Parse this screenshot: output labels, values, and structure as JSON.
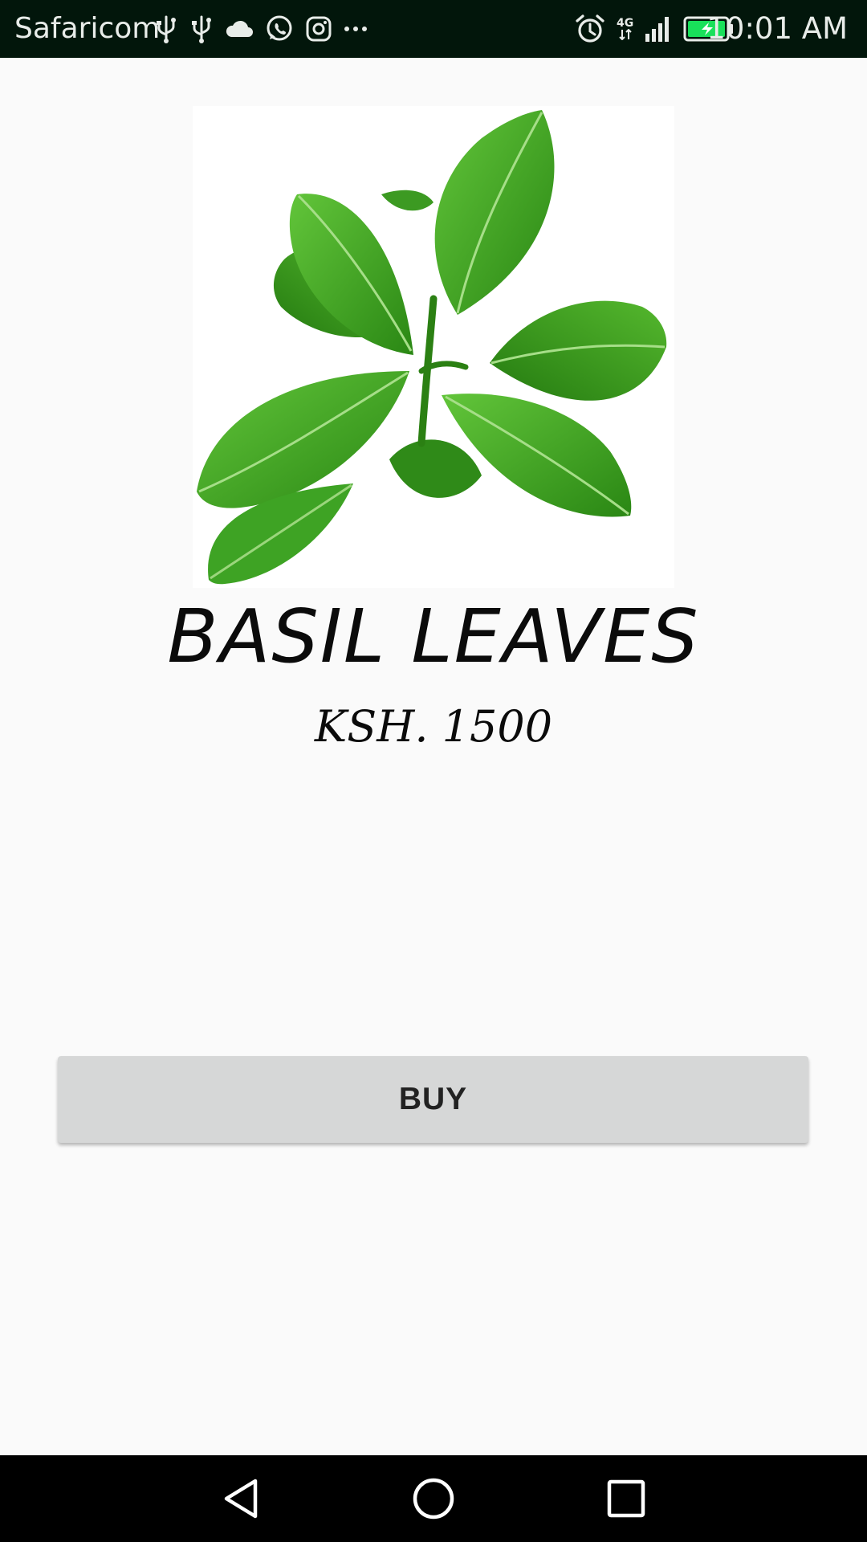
{
  "status_bar": {
    "carrier": "Safaricom",
    "time": "10:01 AM",
    "network_label": "4G",
    "left_icons": [
      "usb-icon",
      "usb-icon",
      "cloud-icon",
      "whatsapp-icon",
      "instagram-icon",
      "more-notifications-icon"
    ],
    "right_icons": [
      "alarm-icon",
      "network-4g-icon",
      "signal-icon",
      "battery-charging-icon"
    ],
    "battery_color": "#19e05a"
  },
  "product": {
    "image": "basil-leaves-image",
    "name": "BASIL LEAVES",
    "price": "KSH. 1500"
  },
  "actions": {
    "buy_label": "BUY"
  },
  "nav_bar": {
    "buttons": [
      "back-icon",
      "home-icon",
      "recents-icon"
    ]
  },
  "colors": {
    "background": "#fafafa",
    "status_bar": "#02160b",
    "button": "#d6d7d7",
    "leaf_green": "#3a9b1c"
  }
}
